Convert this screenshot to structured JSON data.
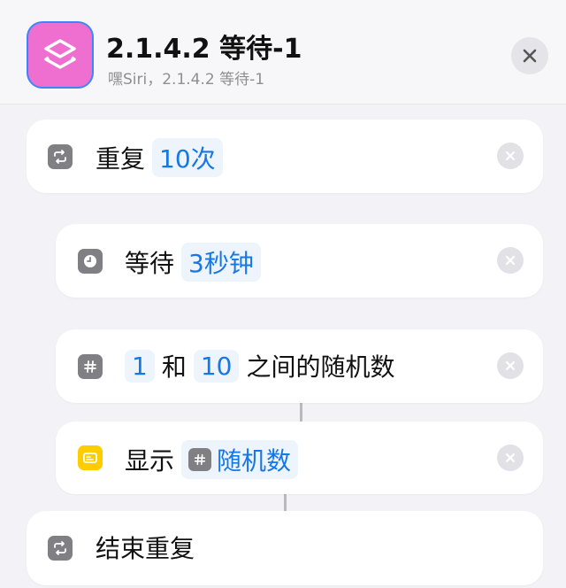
{
  "header": {
    "title": "2.1.4.2 等待-1",
    "subtitle": "嘿Siri，2.1.4.2 等待-1",
    "app_icon": "shortcuts-icon",
    "close_icon": "close-icon"
  },
  "actions": [
    {
      "label": "重复",
      "token": "10次",
      "icon": "repeat-icon"
    },
    {
      "label": "等待",
      "token": "3秒钟",
      "icon": "clock-icon"
    },
    {
      "token_a": "1",
      "connector": "和",
      "token_b": "10",
      "suffix": "之间的随机数",
      "icon": "hash-icon"
    },
    {
      "label": "显示",
      "token": "随机数",
      "icon": "show-icon",
      "token_icon": "hash-icon"
    },
    {
      "label": "结束重复",
      "icon": "repeat-icon"
    }
  ],
  "colors": {
    "accent": "#1677e5",
    "app_icon_bg": "#ef6fd0",
    "action_icon_gray": "#7f7f84",
    "action_icon_yellow": "#ffcc00"
  }
}
